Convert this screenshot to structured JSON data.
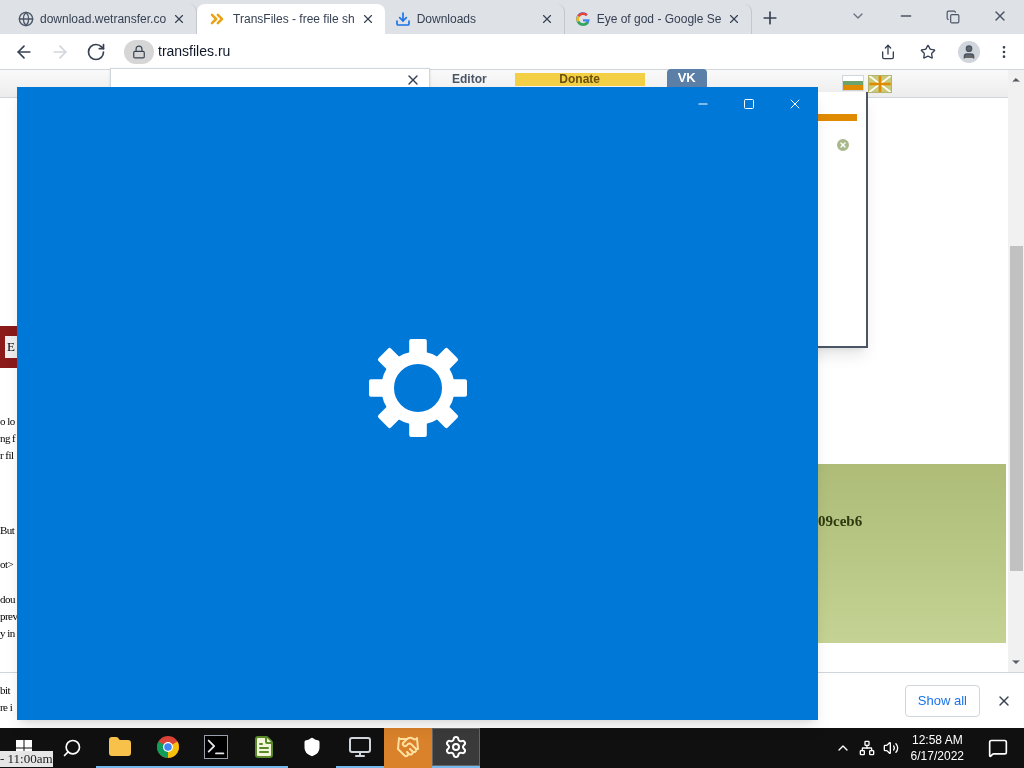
{
  "browser": {
    "tabs": [
      {
        "kind": "globe",
        "title": "download.wetransfer.co",
        "selected": false
      },
      {
        "kind": "chevrons",
        "title": "TransFiles - free file sh",
        "selected": true
      },
      {
        "kind": "download",
        "title": "Downloads",
        "selected": false
      },
      {
        "kind": "google",
        "title": "Eye of god - Google Se",
        "selected": false
      }
    ],
    "nav_buttons": [
      {
        "kind": "back",
        "disabled": false
      },
      {
        "kind": "forward",
        "disabled": true
      },
      {
        "kind": "reload",
        "disabled": false
      }
    ],
    "address": "transfiles.ru"
  },
  "page": {
    "nav": [
      "Editor",
      "Donate",
      "VK"
    ],
    "side_button": "E",
    "paragraphs": [
      [
        "o lo",
        "ng f",
        "r fil"
      ],
      [
        "But"
      ],
      [
        "ot>"
      ],
      [
        "dou",
        "prev",
        "y in"
      ],
      [
        "bit",
        "re i"
      ]
    ],
    "hash": "09ceb6"
  },
  "download_bar": {
    "button": "Show all"
  },
  "overlay_text": "- 11:00am",
  "taskbar": {
    "apps": [
      {
        "kind": "folder",
        "running": true,
        "selected": false,
        "flashing": false
      },
      {
        "kind": "chrome",
        "running": true,
        "selected": false,
        "flashing": false
      },
      {
        "kind": "terminal",
        "running": true,
        "selected": false,
        "flashing": false
      },
      {
        "kind": "notepad",
        "running": true,
        "selected": false,
        "flashing": false
      },
      {
        "kind": "shield",
        "running": false,
        "selected": false,
        "flashing": false
      },
      {
        "kind": "monitor",
        "running": true,
        "selected": false,
        "flashing": false
      },
      {
        "kind": "handshake",
        "running": false,
        "selected": false,
        "flashing": true
      },
      {
        "kind": "gear",
        "running": true,
        "selected": true,
        "flashing": false
      }
    ],
    "time": "12:58 AM",
    "date": "6/17/2022"
  }
}
